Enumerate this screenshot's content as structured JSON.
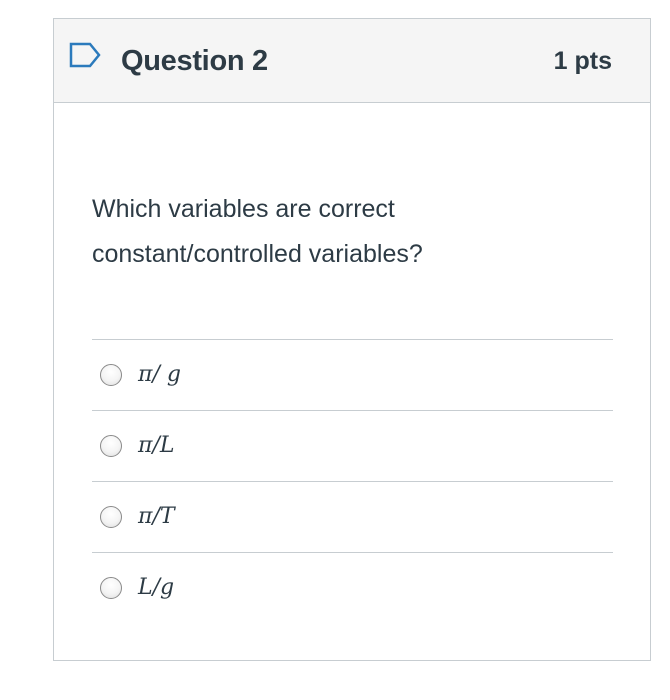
{
  "question": {
    "title": "Question 2",
    "points": "1 pts",
    "text_line1": "Which variables are correct",
    "text_line2": "constant/controlled variables?"
  },
  "answers": [
    {
      "label": "π/ g"
    },
    {
      "label": "π/L"
    },
    {
      "label": "π/T"
    },
    {
      "label": "L/g"
    }
  ],
  "colors": {
    "text": "#2d3b45",
    "header_bg": "#f5f5f5",
    "border": "#c7cdd1",
    "flag": "#2b7abc"
  },
  "icons": {
    "flag": "bookmark-flag-icon"
  }
}
